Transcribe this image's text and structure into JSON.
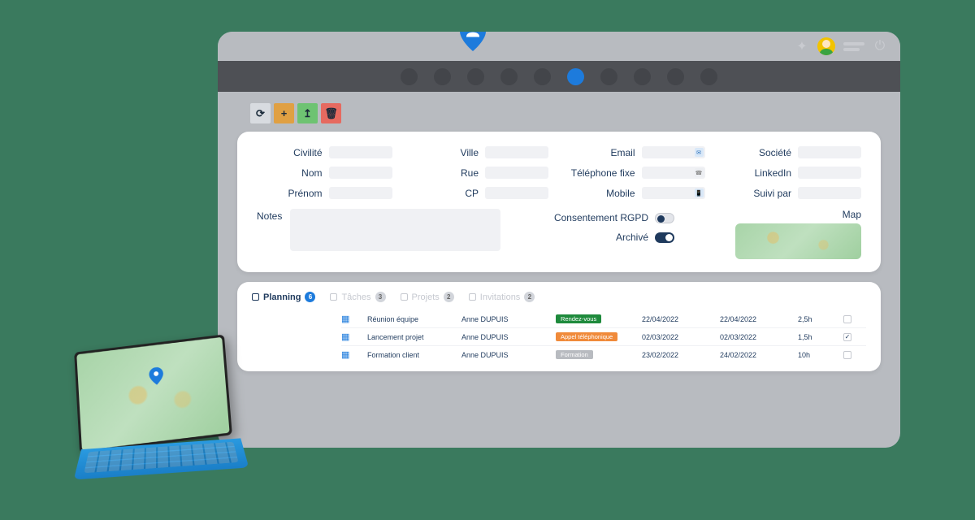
{
  "form": {
    "labels": {
      "civilite": "Civilité",
      "nom": "Nom",
      "prenom": "Prénom",
      "ville": "Ville",
      "rue": "Rue",
      "cp": "CP",
      "email": "Email",
      "telfixe": "Téléphone fixe",
      "mobile": "Mobile",
      "societe": "Société",
      "linkedin": "LinkedIn",
      "suivipar": "Suivi par",
      "notes": "Notes",
      "consentement": "Consentement RGPD",
      "archive": "Archivé",
      "map": "Map"
    }
  },
  "tabs": [
    {
      "key": "planning",
      "label": "Planning",
      "count": "6",
      "active": true
    },
    {
      "key": "taches",
      "label": "Tâches",
      "count": "3",
      "active": false
    },
    {
      "key": "projets",
      "label": "Projets",
      "count": "2",
      "active": false
    },
    {
      "key": "invitations",
      "label": "Invitations",
      "count": "2",
      "active": false
    }
  ],
  "rows": [
    {
      "title": "Réunion équipe",
      "person": "Anne DUPUIS",
      "tagLabel": "Rendez-vous",
      "tagColor": "green",
      "date1": "22/04/2022",
      "date2": "22/04/2022",
      "dur": "2,5h",
      "checked": false
    },
    {
      "title": "Lancement projet",
      "person": "Anne DUPUIS",
      "tagLabel": "Appel téléphonique",
      "tagColor": "orange",
      "date1": "02/03/2022",
      "date2": "02/03/2022",
      "dur": "1,5h",
      "checked": true
    },
    {
      "title": "Formation client",
      "person": "Anne DUPUIS",
      "tagLabel": "Formation",
      "tagColor": "gray",
      "date1": "23/02/2022",
      "date2": "24/02/2022",
      "dur": "10h",
      "checked": false
    }
  ]
}
